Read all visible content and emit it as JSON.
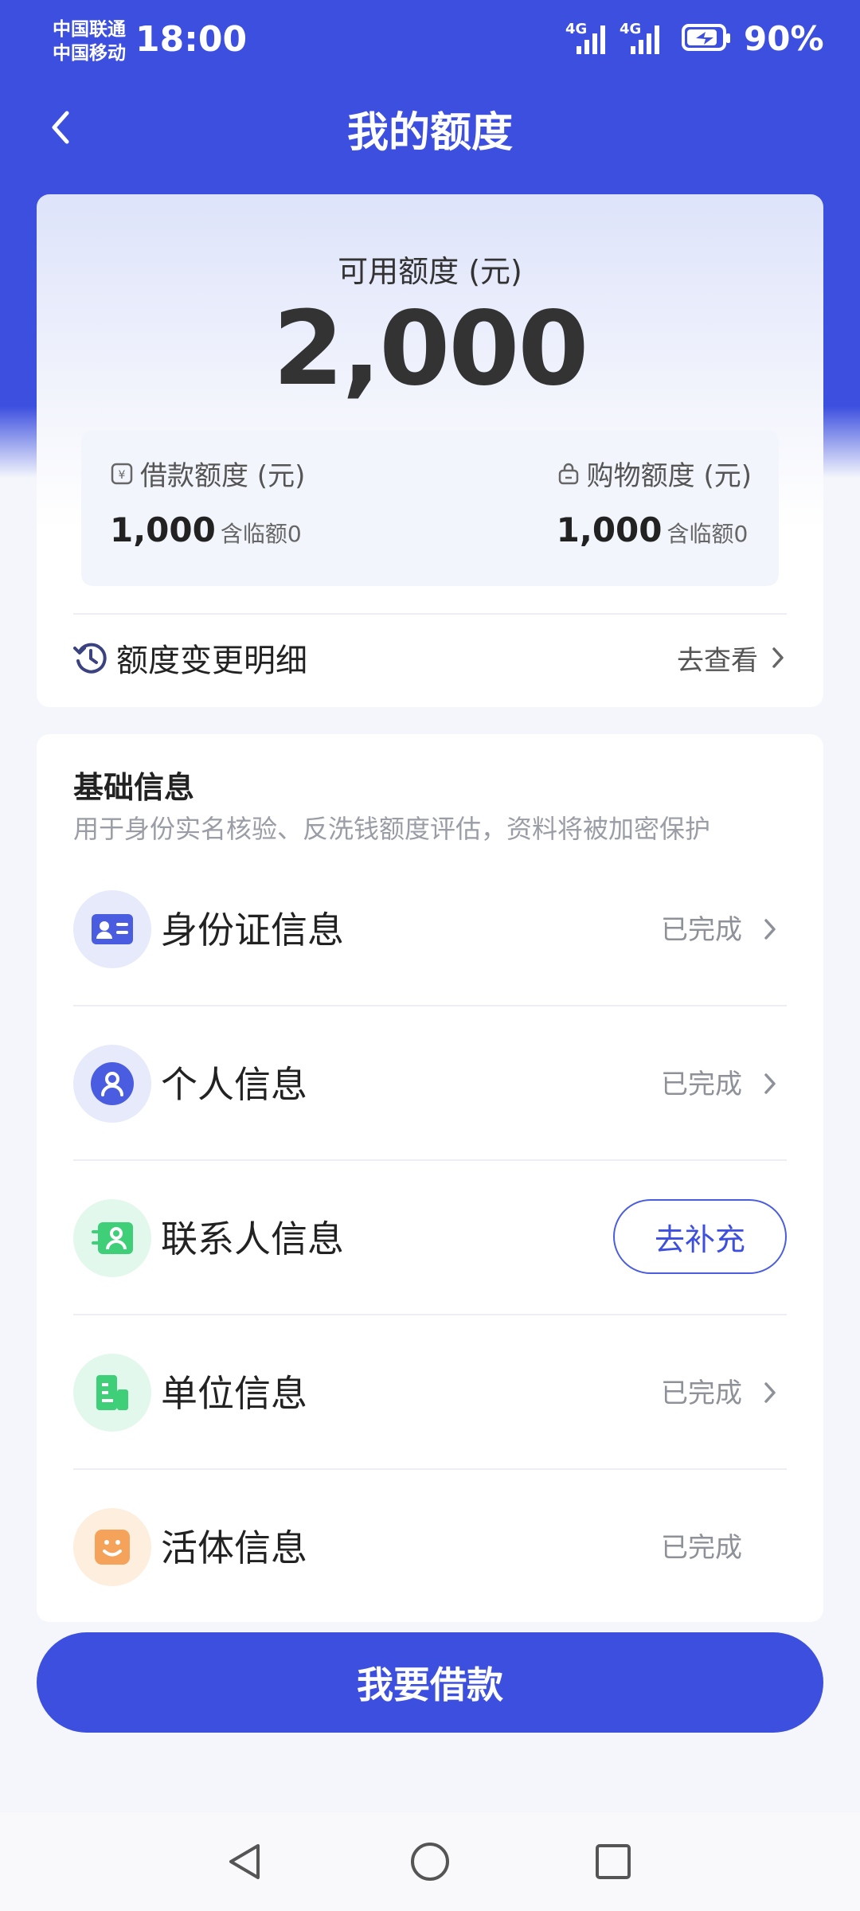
{
  "status_bar": {
    "carrier_1": "中国联通",
    "carrier_2": "中国移动",
    "time": "18:00",
    "network_1": "4G",
    "network_2": "4G",
    "battery": "90%",
    "battery_level": 0.9
  },
  "header": {
    "title": "我的额度",
    "back_icon": "chevron-left-icon"
  },
  "limit": {
    "available_label": "可用额度 (元)",
    "available_value": "2,000",
    "loan": {
      "label": "借款额度 (元)",
      "value": "1,000",
      "note": "含临额0",
      "icon": "yuan-tag-icon"
    },
    "shopping": {
      "label": "购物额度 (元)",
      "value": "1,000",
      "note": "含临额0",
      "icon": "shopping-bag-icon"
    },
    "history": {
      "label": "额度变更明细",
      "link": "去查看",
      "icon": "history-clock-icon"
    }
  },
  "basic_info": {
    "title": "基础信息",
    "description": "用于身份实名核验、反洗钱额度评估，资料将被加密保护",
    "items": [
      {
        "label": "身份证信息",
        "status": "已完成",
        "icon": "id-card-icon",
        "color": "#4a5de0"
      },
      {
        "label": "个人信息",
        "status": "已完成",
        "icon": "person-icon",
        "color": "#4a5de0"
      },
      {
        "label": "联系人信息",
        "action": "去补充",
        "icon": "contacts-icon",
        "color": "#3ecf78"
      },
      {
        "label": "单位信息",
        "status": "已完成",
        "icon": "building-icon",
        "color": "#3ecf78"
      },
      {
        "label": "活体信息",
        "status": "已完成",
        "icon": "face-smile-icon",
        "color": "#f5a25a"
      }
    ]
  },
  "primary_action": {
    "label": "我要借款"
  },
  "system_nav": {
    "back": "triangle-back-icon",
    "home": "circle-home-icon",
    "recents": "square-recents-icon"
  },
  "colors": {
    "brand": "#3c4fdf",
    "background": "#f4f6fc"
  }
}
